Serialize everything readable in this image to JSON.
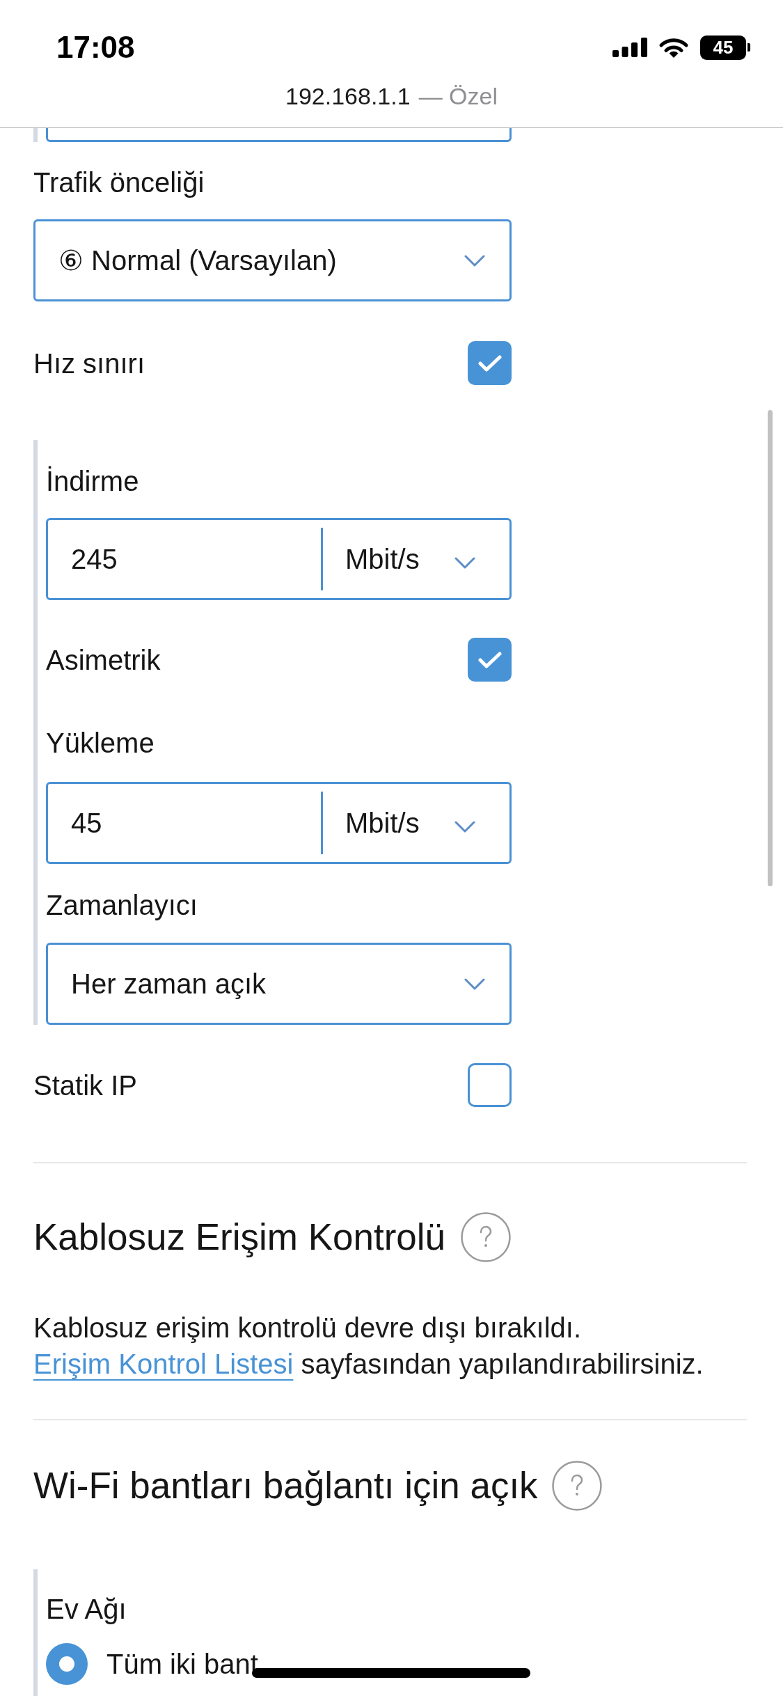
{
  "status_bar": {
    "time": "17:08",
    "battery": "45"
  },
  "address_bar": {
    "host": "192.168.1.1",
    "label": "— Özel"
  },
  "traffic_priority": {
    "label": "Trafik önceliği",
    "value": "⑥ Normal (Varsayılan)"
  },
  "speed_limit": {
    "label": "Hız sınırı",
    "checked": true,
    "download": {
      "label": "İndirme",
      "value": "245",
      "unit": "Mbit/s"
    },
    "asymmetric": {
      "label": "Asimetrik",
      "checked": true
    },
    "upload": {
      "label": "Yükleme",
      "value": "45",
      "unit": "Mbit/s"
    },
    "scheduler": {
      "label": "Zamanlayıcı",
      "value": "Her zaman açık"
    }
  },
  "static_ip": {
    "label": "Statik IP",
    "checked": false
  },
  "wireless_access_control": {
    "title": "Kablosuz Erişim Kontrolü",
    "text_before": "Kablosuz erişim kontrolü devre dışı bırakıldı.",
    "link": "Erişim Kontrol Listesi",
    "text_after": "sayfasından yapılandırabilirsiniz."
  },
  "wifi_bands": {
    "title": "Wi-Fi bantları bağlantı için açık",
    "group_label": "Ev Ağı",
    "options": [
      {
        "label": "Tüm iki bant",
        "selected": true
      }
    ]
  }
}
